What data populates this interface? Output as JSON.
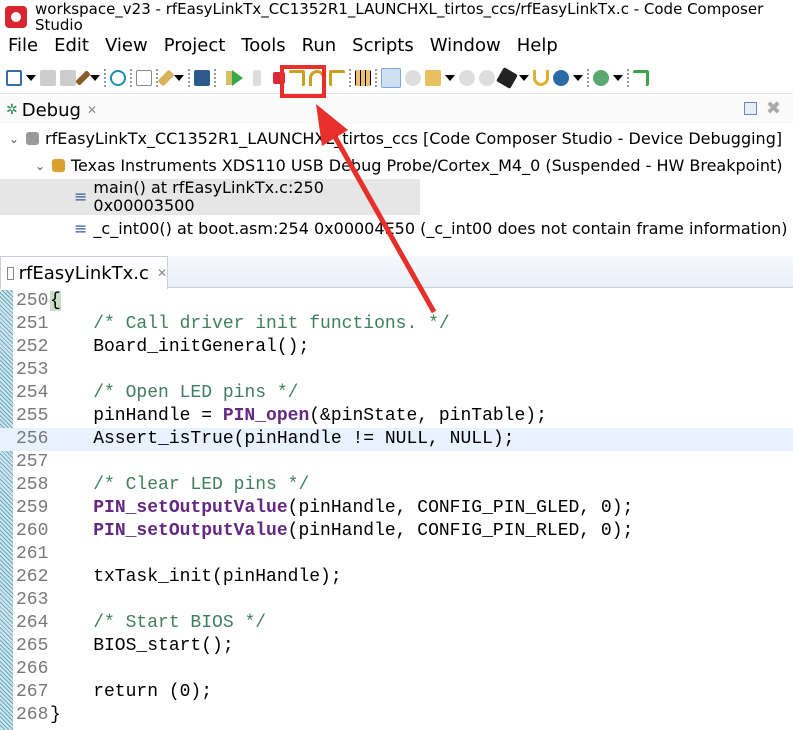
{
  "window": {
    "title": "workspace_v23 - rfEasyLinkTx_CC1352R1_LAUNCHXL_tirtos_ccs/rfEasyLinkTx.c - Code Composer Studio"
  },
  "menu": [
    "File",
    "Edit",
    "View",
    "Project",
    "Tools",
    "Run",
    "Scripts",
    "Window",
    "Help"
  ],
  "toolbar": {
    "icons": [
      "new-icon",
      "save-icon",
      "save-all-icon",
      "build-icon",
      "debug-connect-icon",
      "terminal-icon",
      "flash-icon",
      "registers-icon",
      "resume-icon",
      "suspend-icon",
      "terminate-icon",
      "step-into-icon",
      "step-over-icon",
      "step-return-icon",
      "grid-icon",
      "memory-icon",
      "breakpoint-icon",
      "load-icon",
      "reset-icon",
      "restart-icon",
      "run-icon",
      "debug-icon",
      "assembly-step-icon"
    ],
    "highlighted": "resume-icon",
    "highlight_color": "#e8302a"
  },
  "debug_view": {
    "tab_label": "Debug",
    "tree": [
      {
        "label": "rfEasyLinkTx_CC1352R1_LAUNCHXL_tirtos_ccs [Code Composer Studio - Device Debugging]"
      },
      {
        "label": "Texas Instruments XDS110 USB Debug Probe/Cortex_M4_0 (Suspended - HW Breakpoint)"
      },
      {
        "label": "main() at rfEasyLinkTx.c:250 0x00003500",
        "selected": true
      },
      {
        "label": "_c_int00() at boot.asm:254 0x00004E50  (_c_int00 does not contain frame information)"
      }
    ]
  },
  "editor": {
    "tab_label": "rfEasyLinkTx.c",
    "current_line": 256,
    "lines": [
      {
        "n": "250",
        "t": [
          [
            "brace",
            "{"
          ]
        ]
      },
      {
        "n": "251",
        "t": [
          [
            "",
            "    "
          ],
          [
            "comment",
            "/* Call driver init functions. */"
          ]
        ]
      },
      {
        "n": "252",
        "t": [
          [
            "",
            "    Board_initGeneral();"
          ]
        ]
      },
      {
        "n": "253",
        "t": []
      },
      {
        "n": "254",
        "t": [
          [
            "",
            "    "
          ],
          [
            "comment",
            "/* Open LED pins */"
          ]
        ]
      },
      {
        "n": "255",
        "t": [
          [
            "",
            "    pinHandle = "
          ],
          [
            "fn",
            "PIN_open"
          ],
          [
            "",
            "(&pinState, pinTable);"
          ]
        ]
      },
      {
        "n": "256",
        "t": [
          [
            "",
            "    Assert_isTrue(pinHandle != NULL, NULL);"
          ]
        ]
      },
      {
        "n": "257",
        "t": []
      },
      {
        "n": "258",
        "t": [
          [
            "",
            "    "
          ],
          [
            "comment",
            "/* Clear LED pins */"
          ]
        ]
      },
      {
        "n": "259",
        "t": [
          [
            "",
            "    "
          ],
          [
            "fn",
            "PIN_setOutputValue"
          ],
          [
            "",
            "(pinHandle, CONFIG_PIN_GLED, 0);"
          ]
        ]
      },
      {
        "n": "260",
        "t": [
          [
            "",
            "    "
          ],
          [
            "fn",
            "PIN_setOutputValue"
          ],
          [
            "",
            "(pinHandle, CONFIG_PIN_RLED, 0);"
          ]
        ]
      },
      {
        "n": "261",
        "t": []
      },
      {
        "n": "262",
        "t": [
          [
            "",
            "    txTask_init(pinHandle);"
          ]
        ]
      },
      {
        "n": "263",
        "t": []
      },
      {
        "n": "264",
        "t": [
          [
            "",
            "    "
          ],
          [
            "comment",
            "/* Start BIOS */"
          ]
        ]
      },
      {
        "n": "265",
        "t": [
          [
            "",
            "    BIOS_start();"
          ]
        ]
      },
      {
        "n": "266",
        "t": []
      },
      {
        "n": "267",
        "t": [
          [
            "",
            "    return (0);"
          ]
        ]
      },
      {
        "n": "268",
        "t": [
          [
            "",
            "}"
          ]
        ]
      }
    ]
  }
}
